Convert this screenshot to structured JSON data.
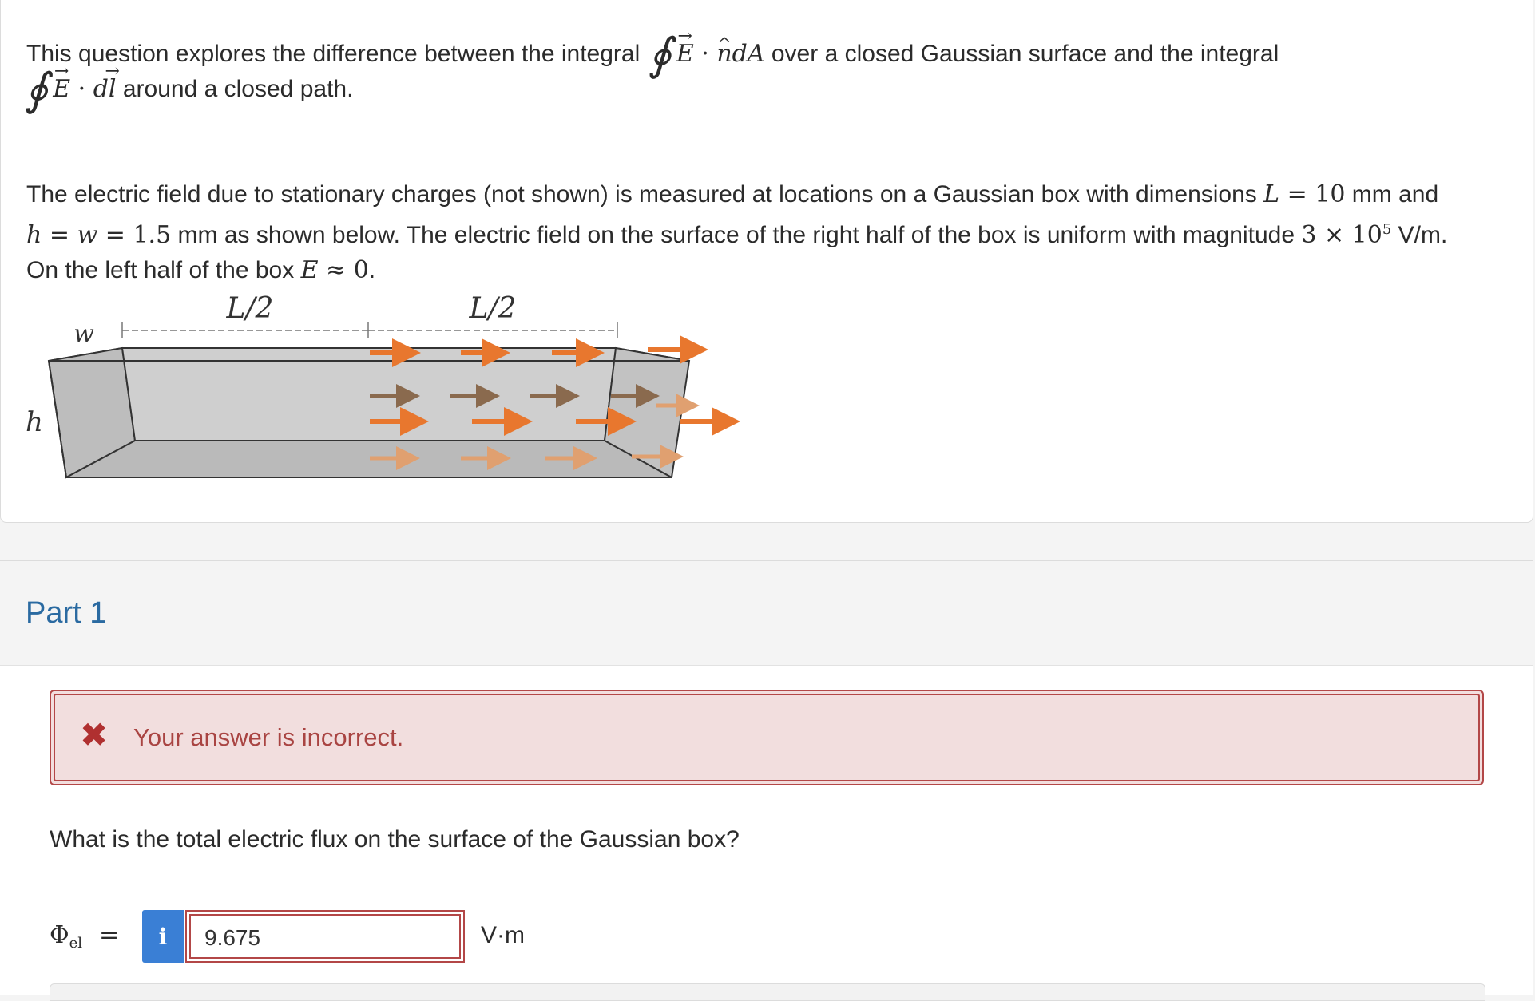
{
  "question": {
    "intro": {
      "before": "This question explores the difference between the integral",
      "oint": "∮",
      "E": "E",
      "dot": " · ",
      "n": "n",
      "dA": "dA",
      "middle": "over a closed Gaussian surface and the integral",
      "dl_d": "d",
      "dl_l": "l",
      "after": "around a closed path."
    },
    "body": {
      "t1": "The electric field due to stationary charges (not shown) is measured at locations on a Gaussian box with dimensions",
      "L": "L",
      "eq1": " = ",
      "Lval": "10",
      "t2": " mm and",
      "h": "h",
      "eq2": " = ",
      "w": "w",
      "eq3": " = ",
      "hval": "1.5",
      "t3": " mm as shown below. The electric field on the surface of the right half of the box is uniform with magnitude",
      "mag_base": "3 × 10",
      "mag_exp": "5",
      "t4": " V/m.",
      "t5": "On the left half of the box",
      "E": "E",
      "approx": " ≈ ",
      "zero": "0",
      "period": "."
    },
    "diagram": {
      "label_half_left": "L/2",
      "label_half_right": "L/2",
      "label_w": "w",
      "label_h": "h",
      "box_color": "#c8c8c8",
      "arrow_color": "#e8772e"
    }
  },
  "part": {
    "title": "Part 1"
  },
  "feedback": {
    "icon": "x-icon",
    "message": "Your answer is incorrect."
  },
  "prompt": "What is the total electric flux on the surface of the Gaussian box?",
  "answer": {
    "symbol": "Φ",
    "subscript": "el",
    "equals": "=",
    "info_label": "i",
    "value": "9.675",
    "units": "V·m"
  }
}
